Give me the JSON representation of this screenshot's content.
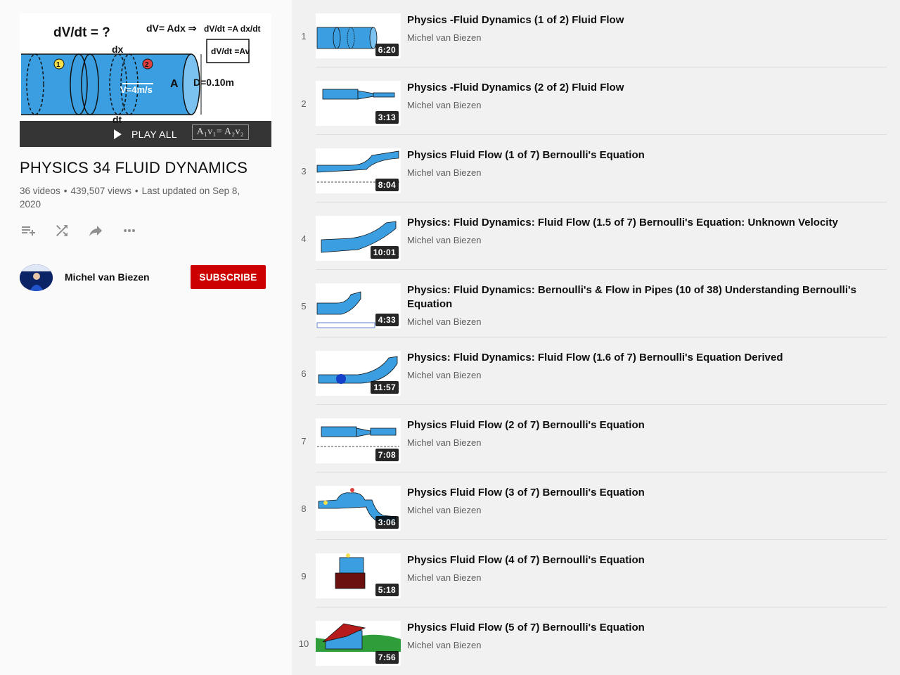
{
  "playlist": {
    "title": "PHYSICS 34 FLUID DYNAMICS",
    "video_count": "36 videos",
    "views": "439,507 views",
    "updated": "Last updated on Sep 8, 2020",
    "play_all_label": "PLAY ALL",
    "hero_equation": "A₁v₁= A₂v₂",
    "hero_text": {
      "q": "dV/dt = ?",
      "f1": "dV= Adx ⇒",
      "f2": "dV/dt =A dx/dt",
      "f3": "dV/dt =Av",
      "dx": "dx",
      "dt": "dt",
      "v": "V=4m/s",
      "a": "A",
      "d": "D=0.10m",
      "p1": "1",
      "p2": "2"
    }
  },
  "owner": {
    "name": "Michel van Biezen",
    "subscribe_label": "SUBSCRIBE"
  },
  "videos": [
    {
      "index": "1",
      "title": "Physics -Fluid Dynamics (1 of 2) Fluid Flow",
      "channel": "Michel van Biezen",
      "duration": "6:20"
    },
    {
      "index": "2",
      "title": "Physics -Fluid Dynamics (2 of 2) Fluid Flow",
      "channel": "Michel van Biezen",
      "duration": "3:13"
    },
    {
      "index": "3",
      "title": "Physics Fluid Flow (1 of 7) Bernoulli's Equation",
      "channel": "Michel van Biezen",
      "duration": "8:04"
    },
    {
      "index": "4",
      "title": "Physics: Fluid Dynamics: Fluid Flow (1.5 of 7) Bernoulli's Equation: Unknown Velocity",
      "channel": "Michel van Biezen",
      "duration": "10:01"
    },
    {
      "index": "5",
      "title": "Physics: Fluid Dynamics: Bernoulli's & Flow in Pipes (10 of 38) Understanding Bernoulli's Equation",
      "channel": "Michel van Biezen",
      "duration": "4:33"
    },
    {
      "index": "6",
      "title": "Physics: Fluid Dynamics: Fluid Flow (1.6 of 7) Bernoulli's Equation Derived",
      "channel": "Michel van Biezen",
      "duration": "11:57"
    },
    {
      "index": "7",
      "title": "Physics Fluid Flow (2 of 7) Bernoulli's Equation",
      "channel": "Michel van Biezen",
      "duration": "7:08"
    },
    {
      "index": "8",
      "title": "Physics Fluid Flow (3 of 7) Bernoulli's Equation",
      "channel": "Michel van Biezen",
      "duration": "3:06"
    },
    {
      "index": "9",
      "title": "Physics Fluid Flow (4 of 7) Bernoulli's Equation",
      "channel": "Michel van Biezen",
      "duration": "5:18"
    },
    {
      "index": "10",
      "title": "Physics Fluid Flow (5 of 7) Bernoulli's Equation",
      "channel": "Michel van Biezen",
      "duration": "7:56"
    }
  ],
  "icons": {
    "add_to_queue": "playlist-add-icon",
    "shuffle": "shuffle-icon",
    "share": "share-icon",
    "more": "more-horiz-icon"
  },
  "colors": {
    "subscribe": "#cc0000",
    "pipe": "#3a9ee0",
    "list_bg": "#f1f1f1",
    "sidebar_bg": "#fafafa"
  }
}
